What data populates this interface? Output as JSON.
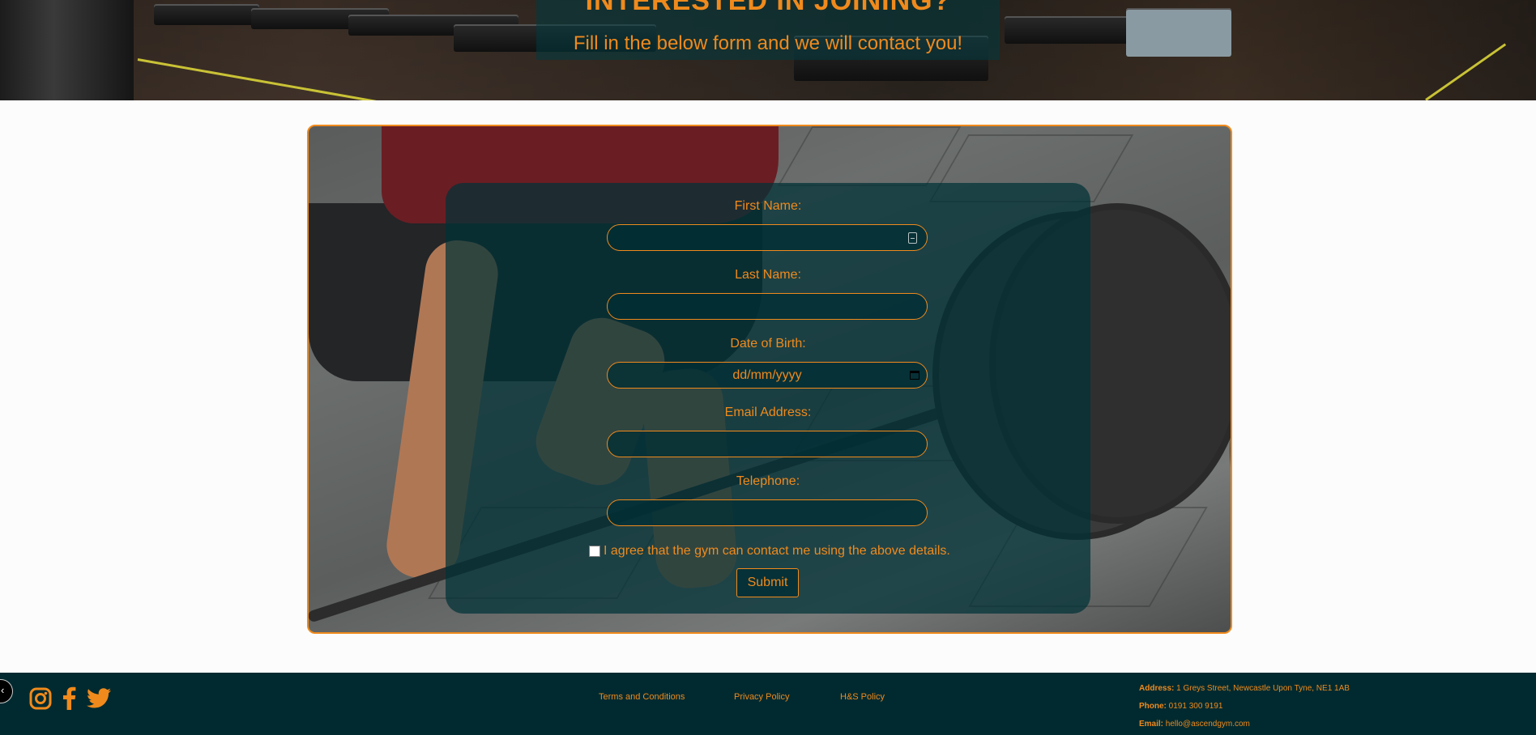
{
  "hero": {
    "heading": "INTERESTED IN JOINING?",
    "subheading": "Fill in the below form and we will contact you!"
  },
  "form": {
    "fields": [
      {
        "label": "First Name:",
        "value": "",
        "placeholder": ""
      },
      {
        "label": "Last Name:",
        "value": "",
        "placeholder": ""
      },
      {
        "label": "Date of Birth:",
        "value": "",
        "placeholder": "dd/mm/yyyy"
      },
      {
        "label": "Email Address:",
        "value": "",
        "placeholder": ""
      },
      {
        "label": "Telephone:",
        "value": "",
        "placeholder": ""
      }
    ],
    "consent_label": "I agree that the gym can contact me using the above details.",
    "consent_checked": false,
    "submit_label": "Submit"
  },
  "footer": {
    "social": [
      {
        "icon": "instagram-icon"
      },
      {
        "icon": "facebook-icon"
      },
      {
        "icon": "twitter-icon"
      }
    ],
    "links": [
      "Terms and Conditions",
      "Privacy Policy",
      "H&S Policy"
    ],
    "contact": {
      "address_label": "Address:",
      "address": "1 Greys Street, Newcastle Upon Tyne, NE1 1AB",
      "phone_label": "Phone:",
      "phone": "0191 300 9191",
      "email_label": "Email:",
      "email": "hello@ascendgym.com"
    },
    "scroll_button_glyph": "‹"
  },
  "colors": {
    "accent": "#f08a1c",
    "footer_bg": "#012a30",
    "panel_bg": "#003238"
  }
}
